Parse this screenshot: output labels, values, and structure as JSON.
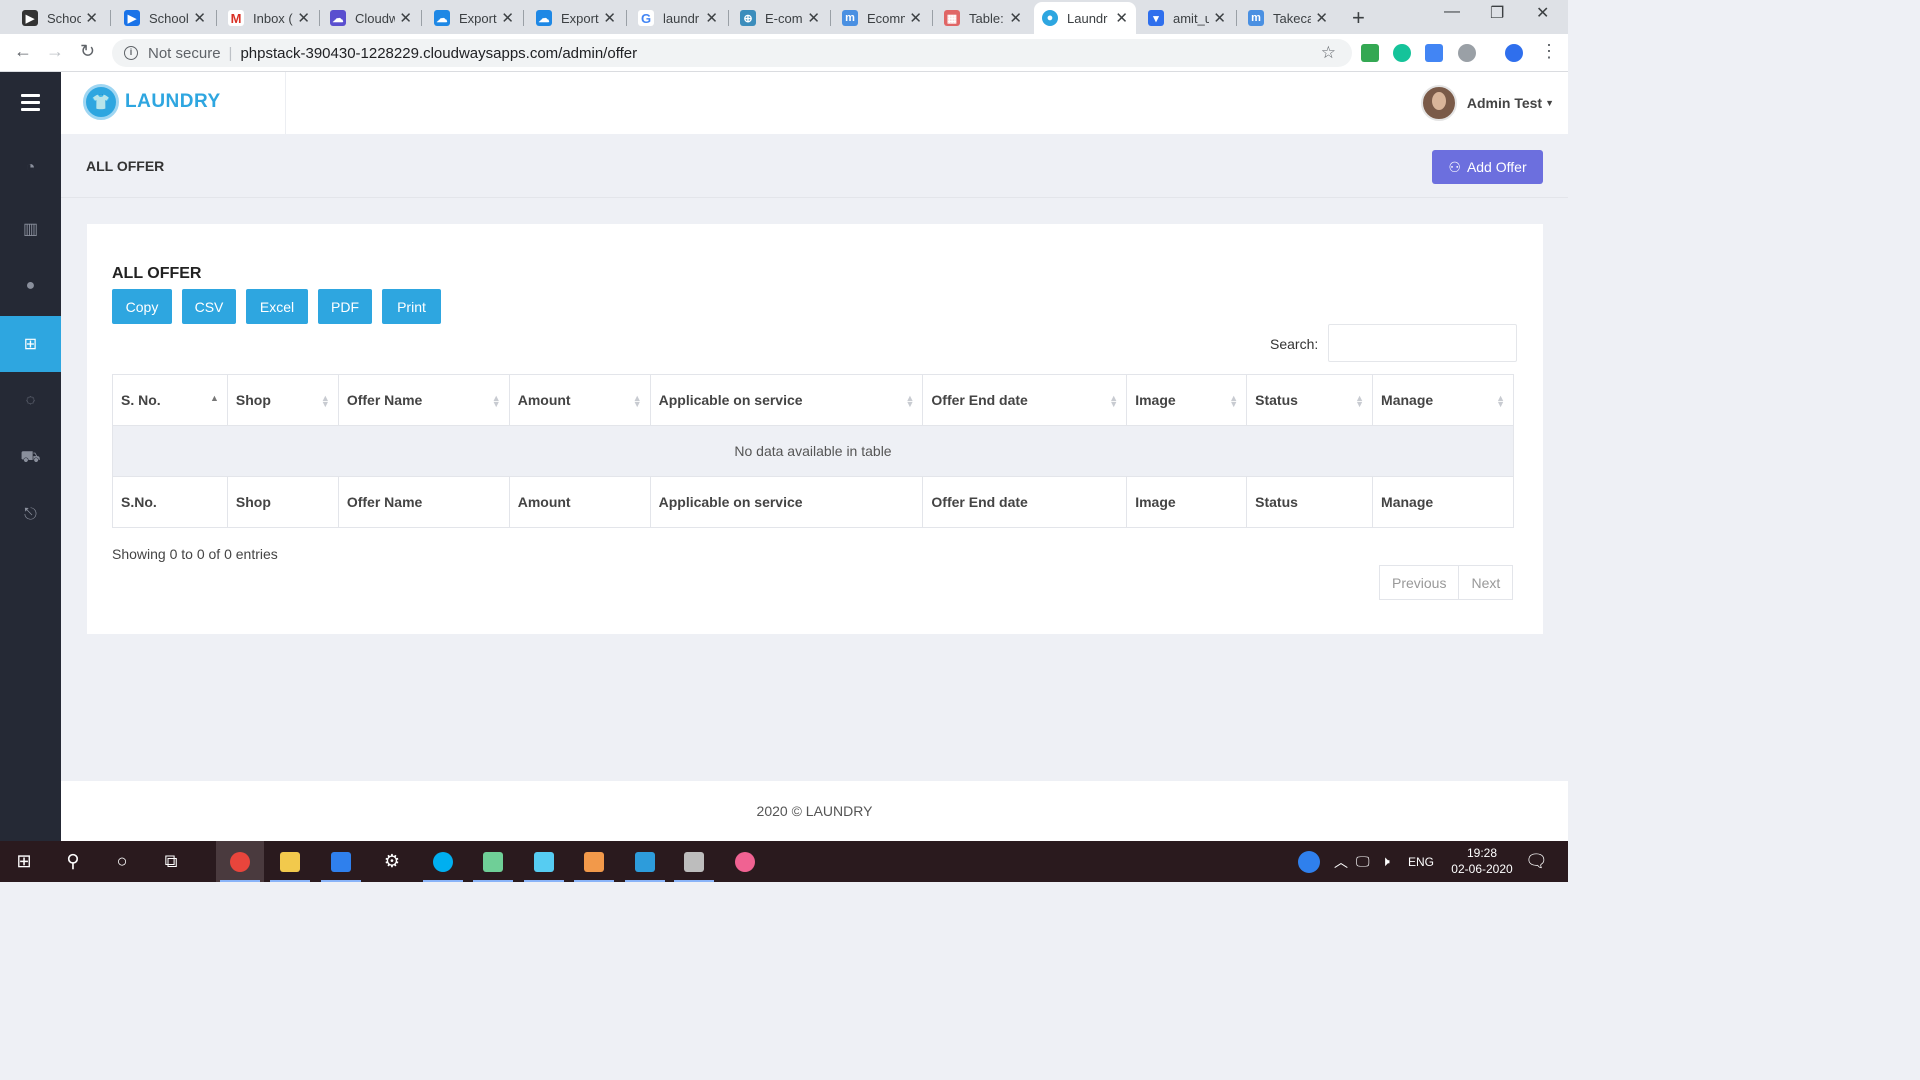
{
  "browser": {
    "tabs": [
      {
        "label": "School",
        "color": "#333333"
      },
      {
        "label": "School",
        "color": "#1a73e8"
      },
      {
        "label": "Inbox (",
        "color": "#d93025"
      },
      {
        "label": "Cloudw",
        "color": "#5a4fcf"
      },
      {
        "label": "Export",
        "color": "#1e88e5"
      },
      {
        "label": "Export",
        "color": "#1e88e5"
      },
      {
        "label": "laundr",
        "color": "#4285f4"
      },
      {
        "label": "E-com",
        "color": "#3c8dbc"
      },
      {
        "label": "Ecomm",
        "color": "#4a90e2"
      },
      {
        "label": "Table: a",
        "color": "#e06666"
      },
      {
        "label": "Laundr",
        "color": "#2ea6e0"
      },
      {
        "label": "amit_u",
        "color": "#2f6fed"
      },
      {
        "label": "Takeca",
        "color": "#4a90e2"
      }
    ],
    "new_tab": "+",
    "address": {
      "security": "Not secure",
      "url": "phpstack-390430-1228229.cloudwaysapps.com/admin/offer"
    }
  },
  "app": {
    "brand": "LAUNDRY",
    "user_name": "Admin Test",
    "sidebar_icons": [
      "dashboard-icon",
      "table-icon",
      "coupon-icon",
      "gift-icon",
      "tag-icon",
      "cart-icon",
      "logout-icon"
    ],
    "active_sidebar": "gift-icon",
    "accent_color": "#2ea6e0",
    "button_color": "#6c6fde"
  },
  "page": {
    "title": "ALL OFFER",
    "add_button": "Add Offer"
  },
  "card": {
    "title": "ALL OFFER",
    "export_buttons": [
      "Copy",
      "CSV",
      "Excel",
      "PDF",
      "Print"
    ],
    "search_label": "Search:",
    "search_value": "",
    "table": {
      "headers": [
        "S. No.",
        "Shop",
        "Offer Name",
        "Amount",
        "Applicable on service",
        "Offer End date",
        "Image",
        "Status",
        "Manage"
      ],
      "footer_headers": [
        "S.No.",
        "Shop",
        "Offer Name",
        "Amount",
        "Applicable on service",
        "Offer End date",
        "Image",
        "Status",
        "Manage"
      ],
      "empty_message": "No data available in table"
    },
    "info": "Showing 0 to 0 of 0 entries",
    "pager": {
      "previous": "Previous",
      "next": "Next"
    }
  },
  "footer": {
    "text": "2020 © LAUNDRY"
  },
  "taskbar": {
    "tray_lang": "ENG",
    "time": "19:28",
    "date": "02-06-2020"
  }
}
